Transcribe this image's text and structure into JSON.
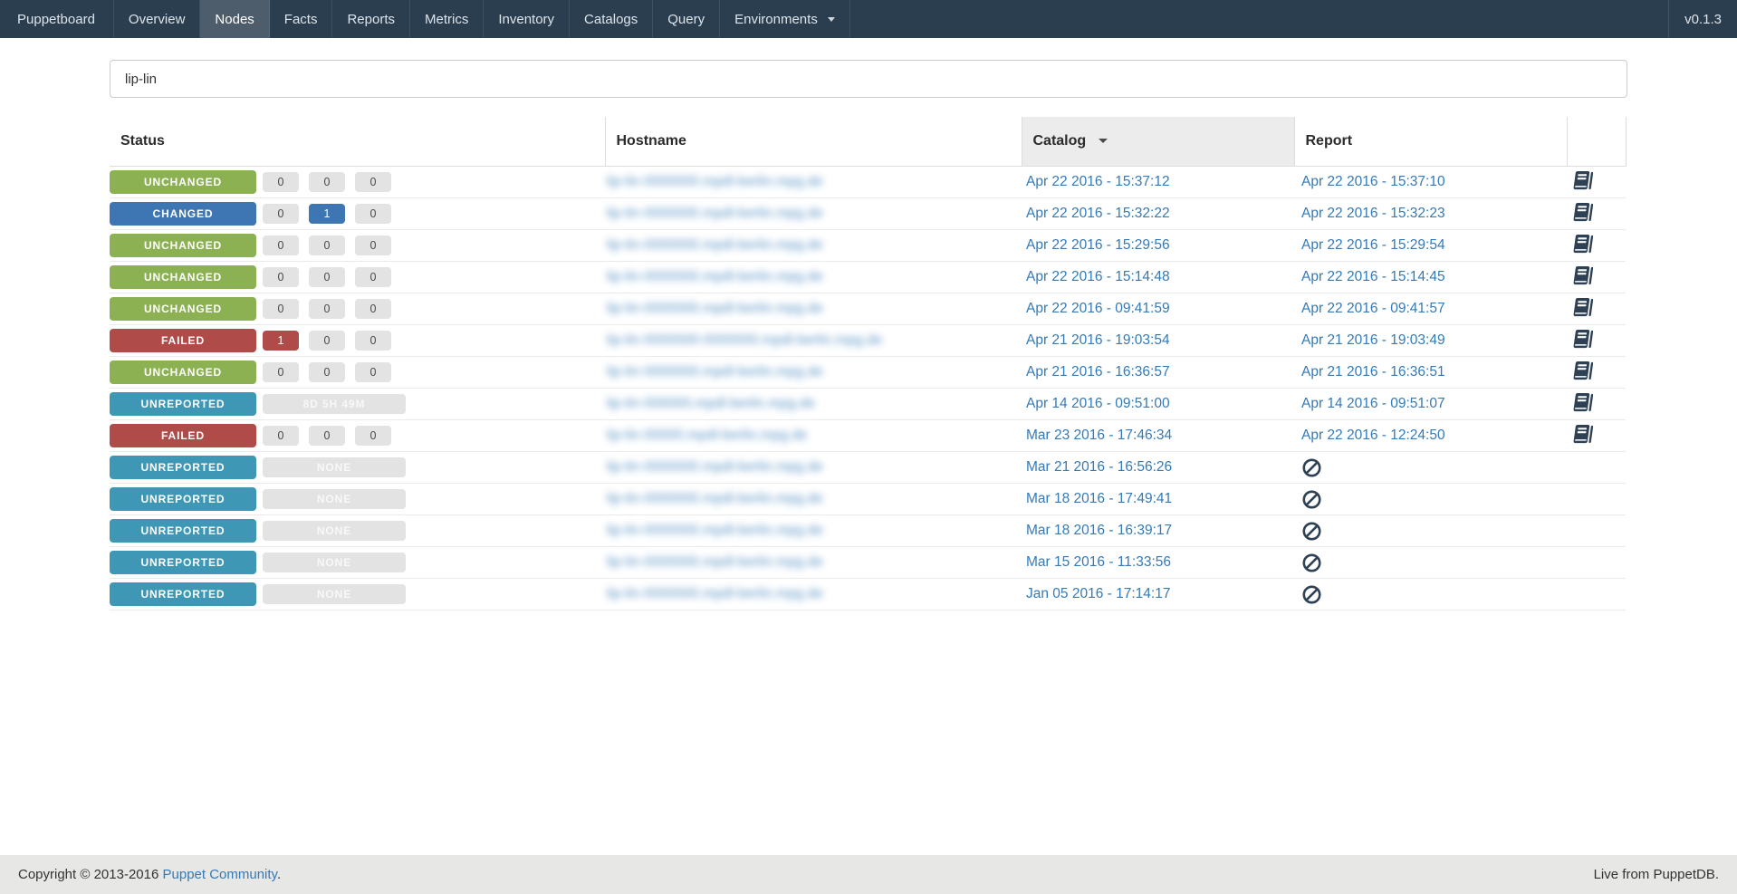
{
  "navbar": {
    "brand": "Puppetboard",
    "items": [
      {
        "label": "Overview"
      },
      {
        "label": "Nodes",
        "active": true
      },
      {
        "label": "Facts"
      },
      {
        "label": "Reports"
      },
      {
        "label": "Metrics"
      },
      {
        "label": "Inventory"
      },
      {
        "label": "Catalogs"
      },
      {
        "label": "Query"
      },
      {
        "label": "Environments",
        "dropdown": true
      }
    ],
    "version": "v0.1.3"
  },
  "search": {
    "value": "lip-lin"
  },
  "table": {
    "headers": [
      "Status",
      "Hostname",
      "Catalog",
      "Report"
    ],
    "sorted_by": "Catalog",
    "sort_direction": "desc",
    "hostname_note": "hostnames are blurred/unreadable in the screenshot; placeholder text is rendered blurred",
    "rows": [
      {
        "status": "UNCHANGED",
        "variant": "unchanged",
        "counters": [
          {
            "text": "0",
            "variant": "default"
          },
          {
            "text": "0",
            "variant": "default"
          },
          {
            "text": "0",
            "variant": "default"
          }
        ],
        "hostname": "lip-lin-0000000.mpdl-berlin.mpg.de",
        "catalog": "Apr 22 2016 - 15:37:12",
        "report": "Apr 22 2016 - 15:37:10",
        "icon": "book"
      },
      {
        "status": "CHANGED",
        "variant": "changed",
        "counters": [
          {
            "text": "0",
            "variant": "default"
          },
          {
            "text": "1",
            "variant": "changed"
          },
          {
            "text": "0",
            "variant": "default"
          }
        ],
        "hostname": "lip-lin-0000000.mpdl-berlin.mpg.de",
        "catalog": "Apr 22 2016 - 15:32:22",
        "report": "Apr 22 2016 - 15:32:23",
        "icon": "book"
      },
      {
        "status": "UNCHANGED",
        "variant": "unchanged",
        "counters": [
          {
            "text": "0",
            "variant": "default"
          },
          {
            "text": "0",
            "variant": "default"
          },
          {
            "text": "0",
            "variant": "default"
          }
        ],
        "hostname": "lip-lin-0000000.mpdl-berlin.mpg.de",
        "catalog": "Apr 22 2016 - 15:29:56",
        "report": "Apr 22 2016 - 15:29:54",
        "icon": "book"
      },
      {
        "status": "UNCHANGED",
        "variant": "unchanged",
        "counters": [
          {
            "text": "0",
            "variant": "default"
          },
          {
            "text": "0",
            "variant": "default"
          },
          {
            "text": "0",
            "variant": "default"
          }
        ],
        "hostname": "lip-lin-0000000.mpdl-berlin.mpg.de",
        "catalog": "Apr 22 2016 - 15:14:48",
        "report": "Apr 22 2016 - 15:14:45",
        "icon": "book"
      },
      {
        "status": "UNCHANGED",
        "variant": "unchanged",
        "counters": [
          {
            "text": "0",
            "variant": "default"
          },
          {
            "text": "0",
            "variant": "default"
          },
          {
            "text": "0",
            "variant": "default"
          }
        ],
        "hostname": "lip-lin-0000000.mpdl-berlin.mpg.de",
        "catalog": "Apr 22 2016 - 09:41:59",
        "report": "Apr 22 2016 - 09:41:57",
        "icon": "book"
      },
      {
        "status": "FAILED",
        "variant": "failed",
        "counters": [
          {
            "text": "1",
            "variant": "failed"
          },
          {
            "text": "0",
            "variant": "default"
          },
          {
            "text": "0",
            "variant": "default"
          }
        ],
        "hostname": "lip-lin-0000000-0000000.mpdl-berlin.mpg.de",
        "catalog": "Apr 21 2016 - 19:03:54",
        "report": "Apr 21 2016 - 19:03:49",
        "icon": "book"
      },
      {
        "status": "UNCHANGED",
        "variant": "unchanged",
        "counters": [
          {
            "text": "0",
            "variant": "default"
          },
          {
            "text": "0",
            "variant": "default"
          },
          {
            "text": "0",
            "variant": "default"
          }
        ],
        "hostname": "lip-lin-0000000.mpdl-berlin.mpg.de",
        "catalog": "Apr 21 2016 - 16:36:57",
        "report": "Apr 21 2016 - 16:36:51",
        "icon": "book"
      },
      {
        "status": "UNREPORTED",
        "variant": "unreported",
        "counters": [
          {
            "text": "8D 5H 49M",
            "variant": "wide"
          }
        ],
        "hostname": "lip-lin-000000.mpdl-berlin.mpg.de",
        "catalog": "Apr 14 2016 - 09:51:00",
        "report": "Apr 14 2016 - 09:51:07",
        "icon": "book"
      },
      {
        "status": "FAILED",
        "variant": "failed",
        "counters": [
          {
            "text": "0",
            "variant": "default"
          },
          {
            "text": "0",
            "variant": "default"
          },
          {
            "text": "0",
            "variant": "default"
          }
        ],
        "hostname": "lip-lin-00000.mpdl-berlin.mpg.de",
        "catalog": "Mar 23 2016 - 17:46:34",
        "report": "Apr 22 2016 - 12:24:50",
        "icon": "book"
      },
      {
        "status": "UNREPORTED",
        "variant": "unreported",
        "counters": [
          {
            "text": "NONE",
            "variant": "wide"
          }
        ],
        "hostname": "lip-lin-0000000.mpdl-berlin.mpg.de",
        "catalog": "Mar 21 2016 - 16:56:26",
        "report": "",
        "icon": "ban"
      },
      {
        "status": "UNREPORTED",
        "variant": "unreported",
        "counters": [
          {
            "text": "NONE",
            "variant": "wide"
          }
        ],
        "hostname": "lip-lin-0000000.mpdl-berlin.mpg.de",
        "catalog": "Mar 18 2016 - 17:49:41",
        "report": "",
        "icon": "ban"
      },
      {
        "status": "UNREPORTED",
        "variant": "unreported",
        "counters": [
          {
            "text": "NONE",
            "variant": "wide"
          }
        ],
        "hostname": "lip-lin-0000000.mpdl-berlin.mpg.de",
        "catalog": "Mar 18 2016 - 16:39:17",
        "report": "",
        "icon": "ban"
      },
      {
        "status": "UNREPORTED",
        "variant": "unreported",
        "counters": [
          {
            "text": "NONE",
            "variant": "wide"
          }
        ],
        "hostname": "lip-lin-0000000.mpdl-berlin.mpg.de",
        "catalog": "Mar 15 2016 - 11:33:56",
        "report": "",
        "icon": "ban"
      },
      {
        "status": "UNREPORTED",
        "variant": "unreported",
        "counters": [
          {
            "text": "NONE",
            "variant": "wide"
          }
        ],
        "hostname": "lip-lin-0000000.mpdl-berlin.mpg.de",
        "catalog": "Jan 05 2016 - 17:14:17",
        "report": "",
        "icon": "ban"
      }
    ]
  },
  "footer": {
    "copyright_prefix": "Copyright © 2013-2016 ",
    "copyright_link": "Puppet Community",
    "copyright_suffix": ".",
    "right": "Live from PuppetDB."
  },
  "colors": {
    "navbar_bg": "#2B3E50",
    "navbar_active_bg": "#4E5D6C",
    "navbar_text": "#DDE4EA",
    "status": {
      "unchanged": "#8CB152",
      "changed": "#3E76B3",
      "failed": "#AF4B48",
      "unreported": "#3D97B5"
    },
    "counter_bg": "#E3E3E3",
    "link": "#337AB7",
    "icon": "#2E4154",
    "sorted_header_bg": "#ECECEC",
    "footer_bg": "#E7E7E6"
  }
}
